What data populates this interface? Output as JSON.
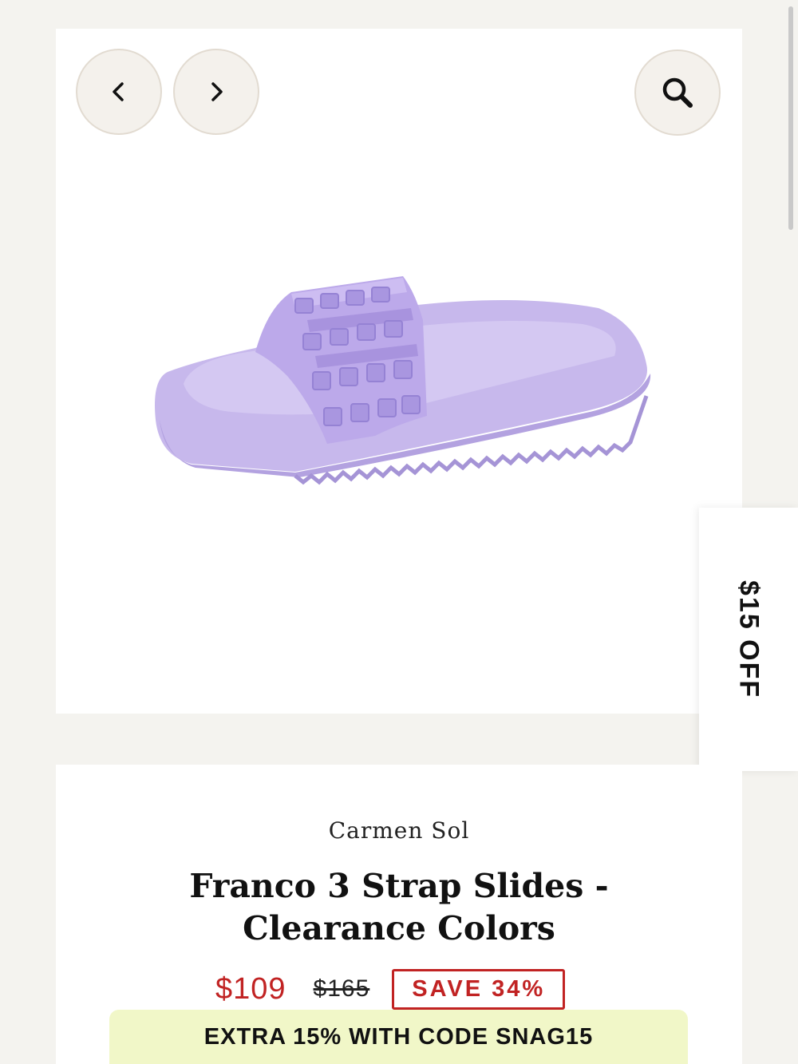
{
  "gallery": {
    "prev_icon": "chevron-left-icon",
    "next_icon": "chevron-right-icon",
    "zoom_icon": "search-icon",
    "product_color": "#c7b8ec"
  },
  "promo": {
    "tab_label": "$15 OFF",
    "close_icon": "close-icon"
  },
  "product": {
    "brand": "Carmen Sol",
    "title_line1": "Franco 3 Strap Slides -",
    "title_line2": "Clearance Colors",
    "sale_price": "$109",
    "original_price": "$165",
    "save_badge": "SAVE 34%",
    "code_banner": "EXTRA 15% WITH CODE SNAG15"
  },
  "colors": {
    "sale_red": "#c12323",
    "banner_bg": "#f1f7c8",
    "page_bg": "#f4f3ef"
  }
}
